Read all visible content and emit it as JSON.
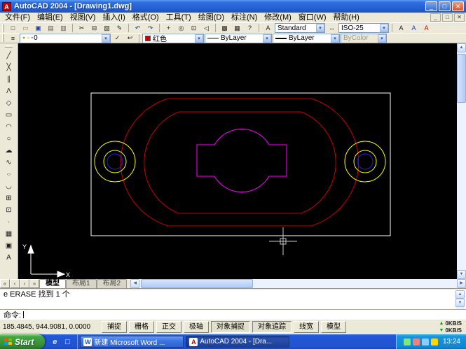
{
  "window": {
    "title": "AutoCAD 2004 - [Drawing1.dwg]"
  },
  "menu": {
    "items": [
      "文件(F)",
      "编辑(E)",
      "视图(V)",
      "插入(I)",
      "格式(O)",
      "工具(T)",
      "绘图(D)",
      "标注(N)",
      "修改(M)",
      "窗口(W)",
      "帮助(H)"
    ]
  },
  "styles_toolbar": {
    "text_style": "Standard",
    "dim_style": "ISO-25"
  },
  "properties_toolbar": {
    "layer": "0",
    "color": "红色",
    "linetype": "ByLayer",
    "lineweight": "ByLayer",
    "plot_style": "ByColor"
  },
  "layout_tabs": {
    "model": "模型",
    "layout1": "布局1",
    "layout2": "布局2"
  },
  "command_window": {
    "history": [
      "e ERASE 找到 1 个",
      ""
    ],
    "prompt": "命令:"
  },
  "status_bar": {
    "coordinates": "185.4845, 944.9081, 0.0000",
    "buttons": [
      {
        "label": "捕捉",
        "pressed": false
      },
      {
        "label": "栅格",
        "pressed": false
      },
      {
        "label": "正交",
        "pressed": false
      },
      {
        "label": "极轴",
        "pressed": false
      },
      {
        "label": "对象捕捉",
        "pressed": true
      },
      {
        "label": "对象追踪",
        "pressed": true
      },
      {
        "label": "线宽",
        "pressed": false
      },
      {
        "label": "模型",
        "pressed": false
      }
    ]
  },
  "net_monitor": {
    "up": "0KB/S",
    "down": "0KB/S"
  },
  "taskbar": {
    "start": "Start",
    "tasks": [
      {
        "label": "新建 Microsoft Word ..."
      },
      {
        "label": "AutoCAD 2004 - [Dra..."
      }
    ],
    "clock": "13:24"
  },
  "canvas": {
    "axis_labels": {
      "x": "X",
      "y": "Y"
    },
    "colors": {
      "background": "#000000",
      "outline": "#FFFFFF",
      "shape_red": "#CC0000",
      "shape_magenta": "#FF00FF",
      "hole_yellow": "#FFFF00",
      "hole_blue": "#2222CC",
      "crosshair": "#C8C8C8"
    }
  },
  "icons": {
    "app": "A",
    "minimize": "_",
    "maximize": "□",
    "close": "✕",
    "mdi_minimize": "_",
    "mdi_restore": "□",
    "mdi_close": "✕",
    "new_file": "□",
    "open_folder": "▭",
    "save": "▣",
    "print": "▤",
    "print_preview": "▥",
    "cut": "✂",
    "copy": "⊟",
    "paste": "▧",
    "match_properties": "✎",
    "undo": "↶",
    "redo": "↷",
    "pan": "+",
    "zoom_realtime": "◎",
    "zoom_window": "⊡",
    "zoom_previous": "◁",
    "properties": "▩",
    "design_center": "▦",
    "help": "?",
    "text_style": "A",
    "dim_style": "↔",
    "text_a1": "A",
    "text_a2": "A",
    "text_a3": "A",
    "layers": "≡",
    "layer_make_current": "✓",
    "layer_previous": "↩",
    "bulb": "●",
    "sun": "☼",
    "lock": "▪",
    "line": "╱",
    "construction_line": "╳",
    "multiline": "∥",
    "polyline": "Λ",
    "polygon": "◇",
    "rectangle": "▭",
    "arc": "◠",
    "circle": "○",
    "revcloud": "☁",
    "spline": "∿",
    "ellipse": "○",
    "ellipse_arc": "◡",
    "insert_block": "⊞",
    "make_block": "⊡",
    "point": "∙",
    "hatch": "▦",
    "region": "▣",
    "mtext": "A",
    "dropdown_arrow": "▾",
    "tab_first": "«",
    "tab_prev": "‹",
    "tab_next": "›",
    "tab_last": "»",
    "up": "▲",
    "down": "▼",
    "left": "◀",
    "right": "▶",
    "net_up": "▲",
    "net_down": "▼",
    "ie": "e",
    "show_desktop": "□",
    "word": "W",
    "acad": "A"
  }
}
